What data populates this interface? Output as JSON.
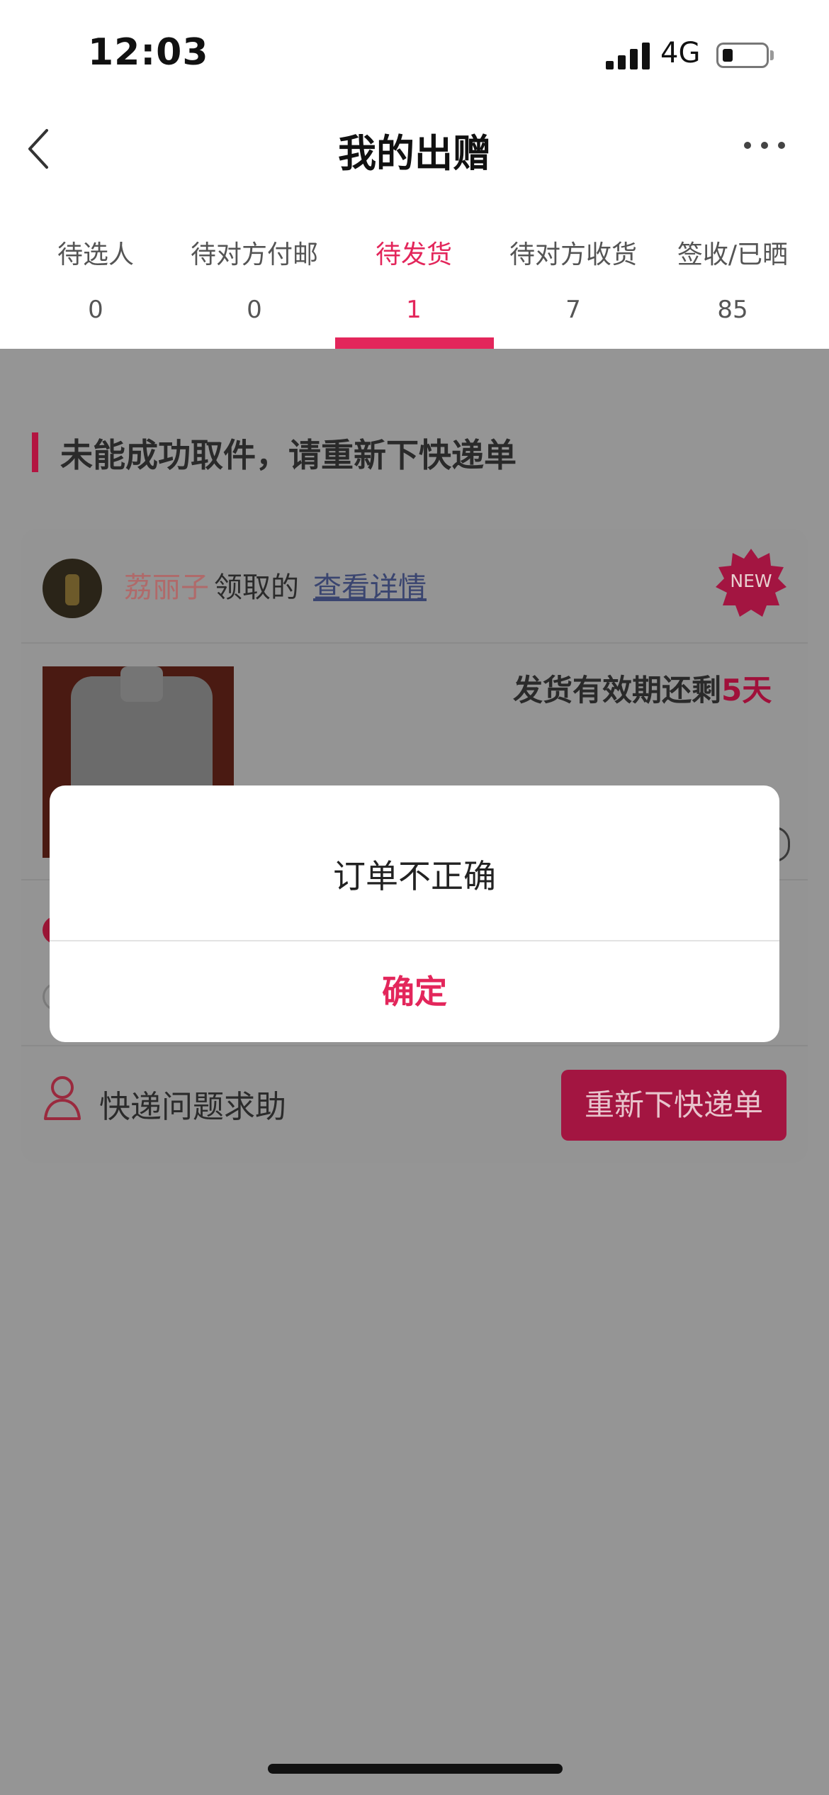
{
  "status_bar": {
    "time": "12:03",
    "network": "4G"
  },
  "header": {
    "title": "我的出赠"
  },
  "tabs": [
    {
      "label": "待选人",
      "count": "0"
    },
    {
      "label": "待对方付邮",
      "count": "0"
    },
    {
      "label": "待发货",
      "count": "1"
    },
    {
      "label": "待对方收货",
      "count": "7"
    },
    {
      "label": "签收/已晒",
      "count": "85"
    }
  ],
  "active_tab_index": 2,
  "section": {
    "title": "未能成功取件，请重新下快递单"
  },
  "card": {
    "claimer_name": "荔丽子",
    "claimed_text": "领取的",
    "detail_link": "查看详情",
    "badge": "NEW",
    "deadline_prefix": "发货有效期还剩",
    "deadline_days": "5天"
  },
  "footer_actions": {
    "help_label": "快递问题求助",
    "reship_button": "重新下快递单"
  },
  "modal": {
    "message": "订单不正确",
    "confirm": "确定"
  },
  "colors": {
    "accent": "#e3265b",
    "overlay": "#959595"
  },
  "icons": [
    "back-arrow-icon",
    "more-icon",
    "new-badge-icon",
    "person-icon",
    "signal-icon",
    "battery-icon"
  ]
}
